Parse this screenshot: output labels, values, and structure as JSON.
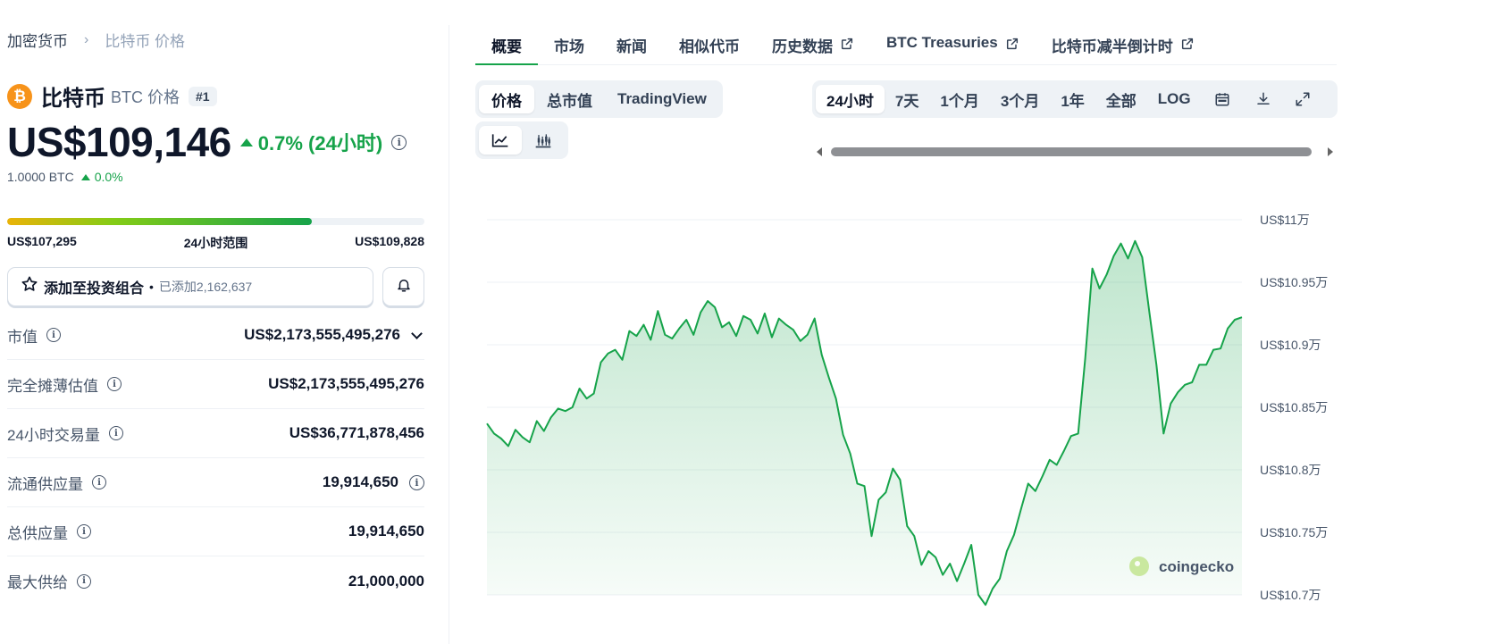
{
  "breadcrumb": {
    "home": "加密货币",
    "separator": "›",
    "current": "比特币 价格"
  },
  "coin": {
    "name": "比特币",
    "symbol_label": "BTC 价格",
    "rank": "#1",
    "logo_glyph": "₿"
  },
  "price": {
    "value": "US$109,146",
    "change": "0.7% (24小时)",
    "btc_value": "1.0000 BTC",
    "btc_change": "0.0%"
  },
  "range_24h": {
    "low": "US$107,295",
    "label": "24小时范围",
    "high": "US$109,828",
    "position_pct": 73
  },
  "portfolio": {
    "label": "添加至投资组合",
    "dot": "•",
    "added": "已添加2,162,637"
  },
  "stats": [
    {
      "label": "市值",
      "value": "US$2,173,555,495,276",
      "has_chevron": true
    },
    {
      "label": "完全摊薄估值",
      "value": "US$2,173,555,495,276"
    },
    {
      "label": "24小时交易量",
      "value": "US$36,771,878,456"
    },
    {
      "label": "流通供应量",
      "value": "19,914,650",
      "has_info": true
    },
    {
      "label": "总供应量",
      "value": "19,914,650"
    },
    {
      "label": "最大供给",
      "value": "21,000,000"
    }
  ],
  "tabs": [
    {
      "label": "概要",
      "active": true
    },
    {
      "label": "市场"
    },
    {
      "label": "新闻"
    },
    {
      "label": "相似代币"
    },
    {
      "label": "历史数据",
      "external": true
    },
    {
      "label": "BTC Treasuries",
      "external": true
    },
    {
      "label": "比特币减半倒计时",
      "external": true
    }
  ],
  "chart_type_options": [
    "价格",
    "总市值",
    "TradingView"
  ],
  "chart_type_selected": "价格",
  "chart_style_options": [
    {
      "icon": "line-chart-icon",
      "selected": true
    },
    {
      "icon": "candlestick-chart-icon"
    }
  ],
  "time_ranges": [
    "24小时",
    "7天",
    "1个月",
    "3个月",
    "1年",
    "全部",
    "LOG"
  ],
  "time_range_selected": "24小时",
  "range_tools": [
    "calendar-icon",
    "download-icon",
    "expand-icon"
  ],
  "watermark": "coingecko",
  "colors": {
    "accent_green": "#16a34a",
    "brand_orange": "#f7931a",
    "chart_line": "#16a34a"
  },
  "chart_data": {
    "type": "area",
    "title": "",
    "xlabel": "",
    "ylabel": "",
    "y_tick_labels": [
      "US$11万",
      "US$10.95万",
      "US$10.9万",
      "US$10.85万",
      "US$10.8万",
      "US$10.75万",
      "US$10.7万"
    ],
    "y_ticks": [
      110000,
      109500,
      109000,
      108500,
      108000,
      107500,
      107000
    ],
    "ylim": [
      107000,
      110000
    ],
    "grid": true,
    "series": [
      {
        "values": [
          108370,
          108290,
          108250,
          108190,
          108320,
          108260,
          108220,
          108390,
          108310,
          108420,
          108490,
          108470,
          108500,
          108650,
          108570,
          108610,
          108860,
          108930,
          108960,
          108880,
          109110,
          109070,
          109160,
          109040,
          109270,
          109080,
          109050,
          109130,
          109200,
          109080,
          109260,
          109350,
          109300,
          109140,
          109180,
          109070,
          109230,
          109200,
          109090,
          109250,
          109060,
          109210,
          109160,
          109120,
          109030,
          109080,
          109210,
          108920,
          108740,
          108570,
          108280,
          108130,
          107890,
          107870,
          107470,
          107760,
          107820,
          108010,
          107920,
          107550,
          107470,
          107240,
          107350,
          107300,
          107160,
          107250,
          107110,
          107250,
          107400,
          107000,
          106920,
          107050,
          107130,
          107350,
          107480,
          107690,
          107890,
          107830,
          107950,
          108080,
          108040,
          108150,
          108270,
          108290,
          108890,
          109610,
          109450,
          109560,
          109710,
          109810,
          109690,
          109830,
          109700,
          109260,
          108840,
          108290,
          108530,
          108620,
          108680,
          108700,
          108840,
          108840,
          108960,
          108970,
          109130,
          109200,
          109220
        ]
      }
    ]
  }
}
